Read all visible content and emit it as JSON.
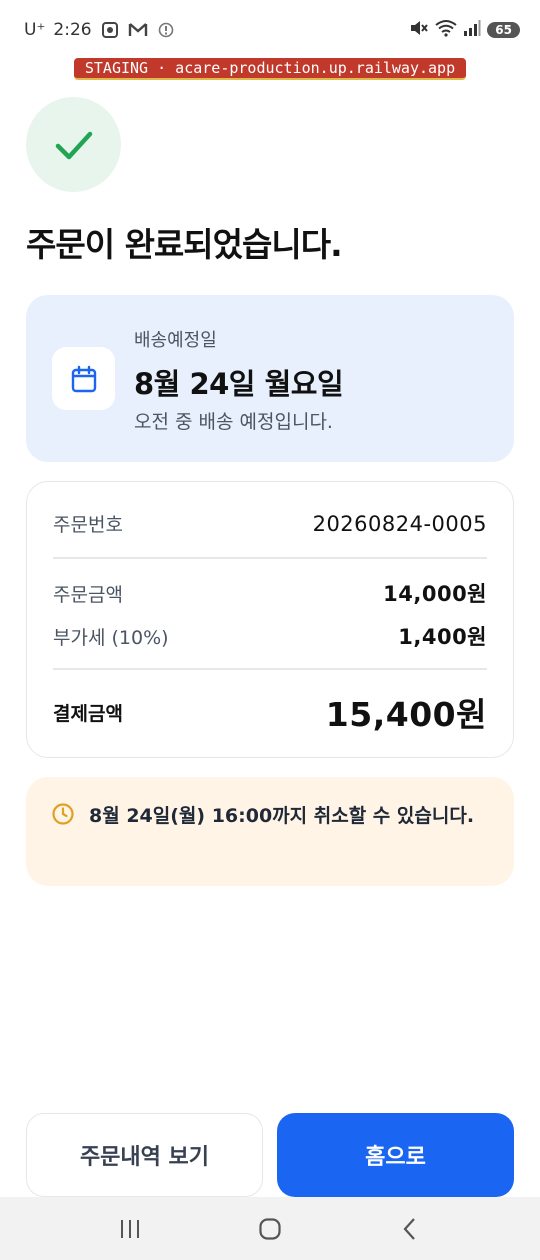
{
  "status_bar": {
    "carrier": "U⁺",
    "time": "2:26",
    "battery": "65",
    "icons": [
      "screenshot-icon",
      "gmail-icon",
      "info-icon",
      "mute-icon",
      "wifi-icon",
      "signal-icon"
    ]
  },
  "staging_banner": "STAGING · acare-production.up.railway.app",
  "title": "주문이 완료되었습니다.",
  "delivery": {
    "label": "배송예정일",
    "date": "8월 24일 월요일",
    "note": "오전 중 배송 예정입니다.",
    "icon": "calendar-icon"
  },
  "order": {
    "number_label": "주문번호",
    "number_value": "20260824-0005",
    "amount_label": "주문금액",
    "amount_value": "14,000원",
    "vat_label": "부가세 (10%)",
    "vat_value": "1,400원",
    "total_label": "결제금액",
    "total_value": "15,400원"
  },
  "cancel_notice": {
    "text": "8월 24일(월) 16:00까지 취소할 수 있습니다.",
    "icon": "clock-icon"
  },
  "buttons": {
    "history": "주문내역 보기",
    "home": "홈으로"
  },
  "colors": {
    "primary": "#1a66f2",
    "success": "#22a455",
    "delivery_bg": "#e8effd",
    "notice_bg": "#fff4e6",
    "notice_icon": "#e0a020",
    "staging": "#c0392b"
  }
}
